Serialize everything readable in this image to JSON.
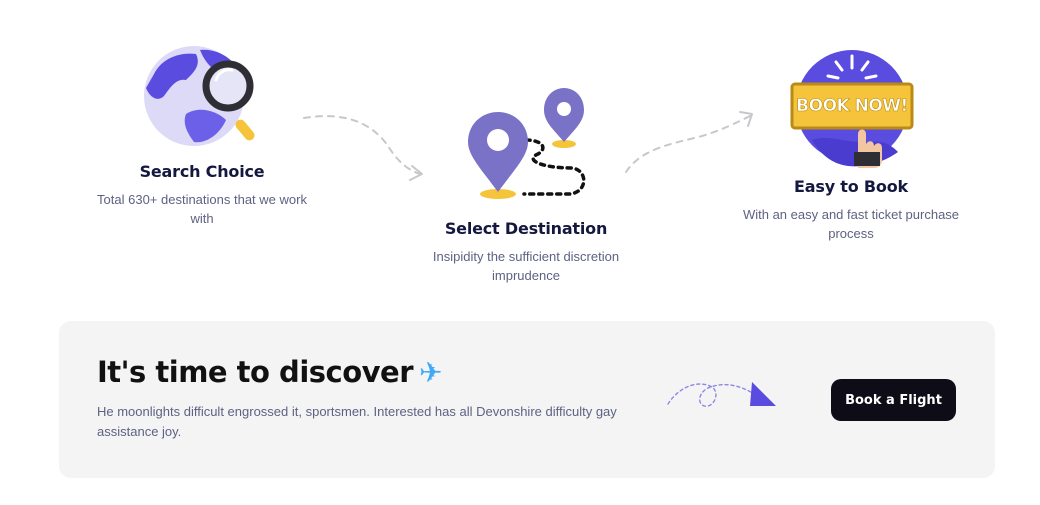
{
  "steps": [
    {
      "title": "Search Choice",
      "description": "Total 630+ destinations that we work with",
      "icon": "globe-search-icon"
    },
    {
      "title": "Select Destination",
      "description": "Insipidity the sufficient discretion imprudence",
      "icon": "map-pin-route-icon"
    },
    {
      "title": "Easy to Book",
      "description": "With an easy and fast ticket purchase process",
      "icon": "book-now-icon"
    }
  ],
  "book_now_sign": "BOOK NOW!",
  "banner": {
    "title": "It's time to discover",
    "plane_glyph": "✈",
    "text": "He moonlights difficult engrossed it, sportsmen. Interested has all Devonshire difficulty gay assistance joy.",
    "cta_label": "Book a Flight"
  },
  "colors": {
    "accent": "#5B4CE0",
    "pin": "#7A72C7",
    "gold": "#F5C43B",
    "cta_bg": "#0D0C17",
    "banner_bg": "#F4F4F5"
  }
}
